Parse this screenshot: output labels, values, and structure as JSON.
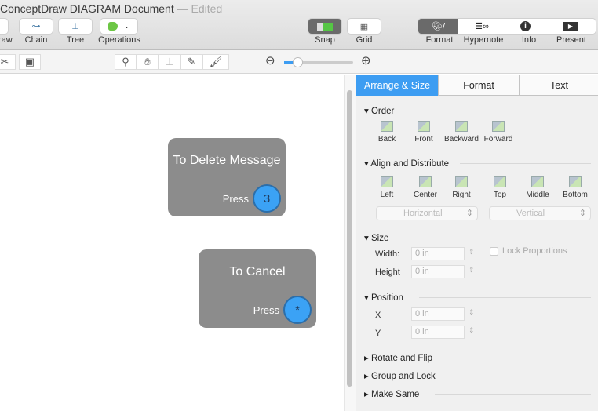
{
  "window": {
    "title": "ConceptDraw DIAGRAM Document",
    "edited": "— Edited"
  },
  "toolbar": {
    "left": [
      {
        "label": "raw"
      },
      {
        "label": "Chain"
      },
      {
        "label": "Tree"
      },
      {
        "label": "Operations"
      }
    ],
    "right": [
      {
        "label": "Snap"
      },
      {
        "label": "Grid"
      },
      {
        "label": "Format"
      },
      {
        "label": "Hypernote"
      },
      {
        "label": "Info"
      },
      {
        "label": "Present"
      }
    ]
  },
  "canvas": {
    "shapes": [
      {
        "title": "To Delete Message",
        "press": "Press",
        "key": "3"
      },
      {
        "title": "To Cancel",
        "press": "Press",
        "key": "*"
      }
    ]
  },
  "panel": {
    "tabs": [
      "Arrange & Size",
      "Format",
      "Text"
    ],
    "order": {
      "title": "Order",
      "items": [
        "Back",
        "Front",
        "Backward",
        "Forward"
      ]
    },
    "align": {
      "title": "Align and Distribute",
      "items": [
        "Left",
        "Center",
        "Right",
        "Top",
        "Middle",
        "Bottom"
      ],
      "horizontal": "Horizontal",
      "vertical": "Vertical"
    },
    "size": {
      "title": "Size",
      "width_label": "Width:",
      "width": "0 in",
      "height_label": "Height",
      "height": "0 in",
      "lock": "Lock Proportions"
    },
    "position": {
      "title": "Position",
      "x_label": "X",
      "x": "0 in",
      "y_label": "Y",
      "y": "0 in"
    },
    "collapsed": [
      "Rotate and Flip",
      "Group and Lock",
      "Make Same"
    ]
  },
  "colors": {
    "accent": "#3d9df2",
    "shape": "#8c8c8c",
    "key": "#3ba2f5"
  }
}
